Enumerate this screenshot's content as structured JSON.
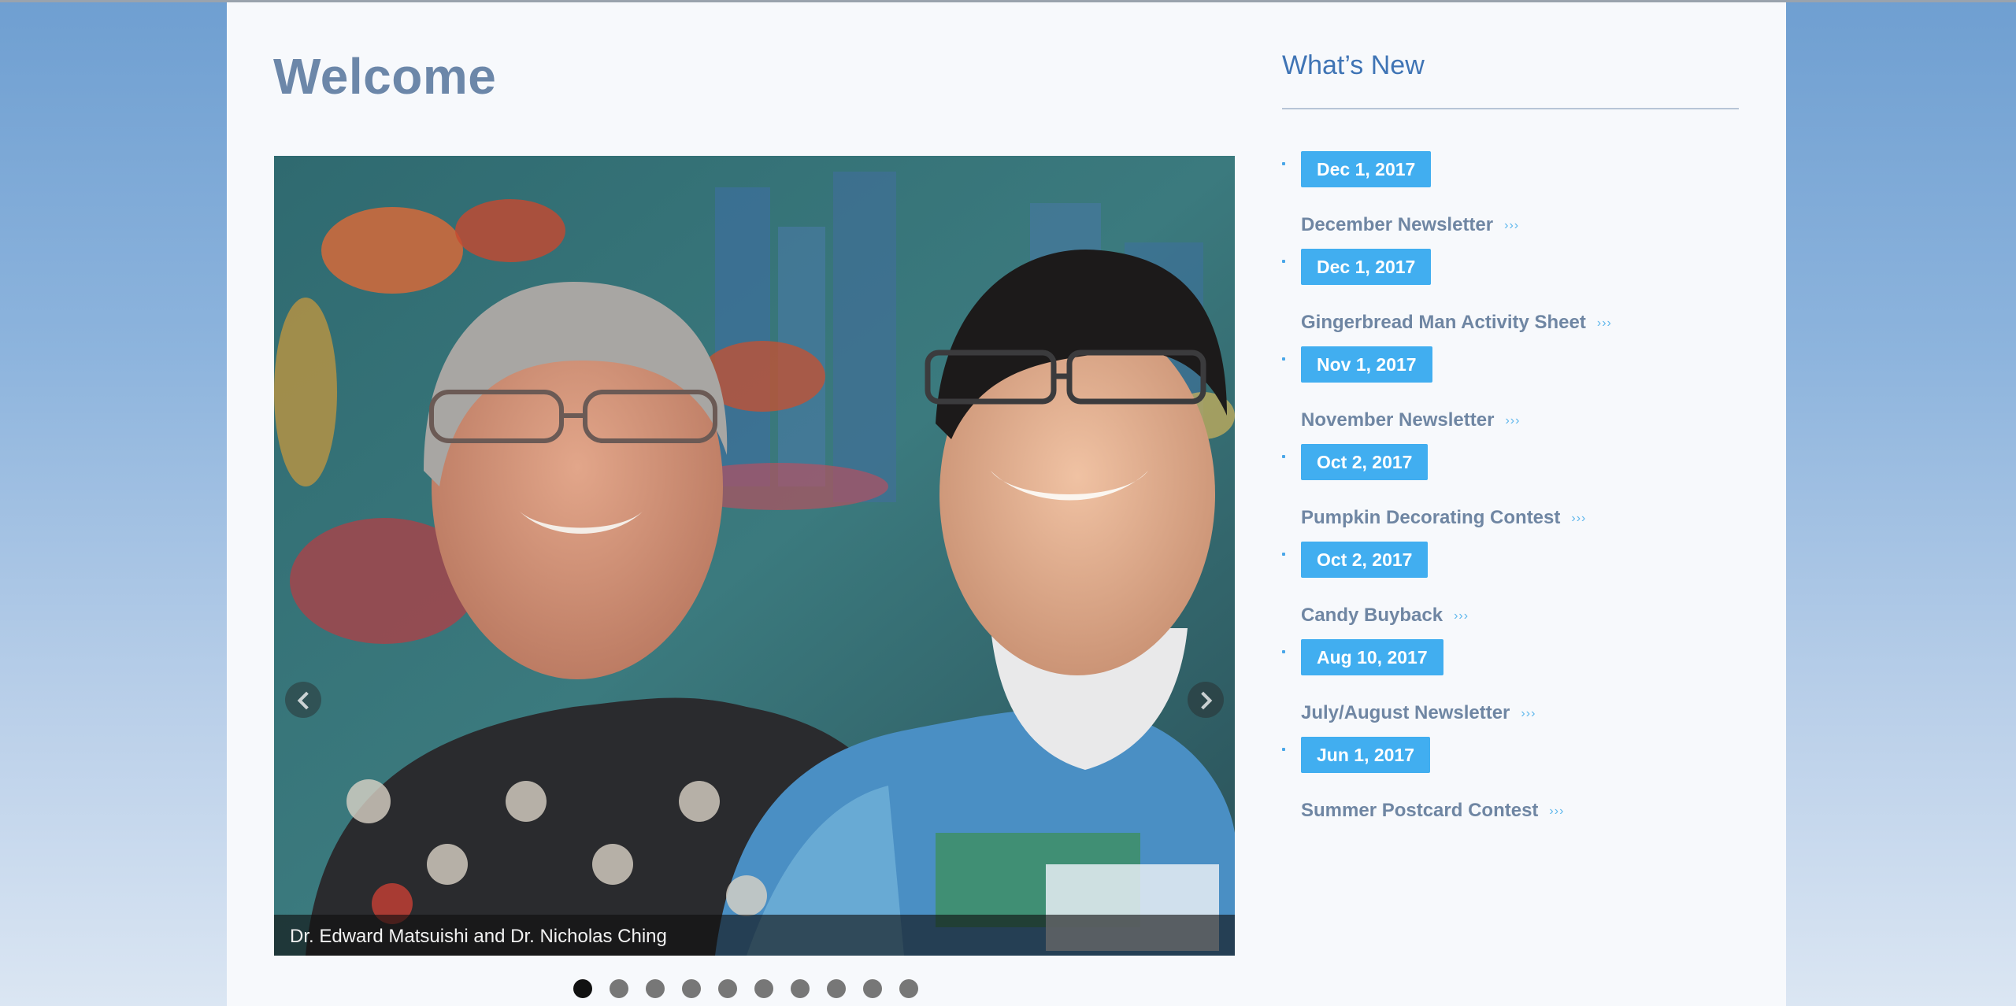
{
  "page": {
    "title": "Welcome"
  },
  "slider": {
    "caption": "Dr. Edward Matsuishi and Dr. Nicholas Ching",
    "dot_count": 10,
    "active_dot": 1,
    "prev_icon": "chevron-left-icon",
    "next_icon": "chevron-right-icon"
  },
  "whats_new": {
    "heading": "What’s New",
    "chevron_glyph": "›››",
    "items": [
      {
        "date": "Dec 1, 2017",
        "title": "December Newsletter"
      },
      {
        "date": "Dec 1, 2017",
        "title": "Gingerbread Man Activity Sheet"
      },
      {
        "date": "Nov 1, 2017",
        "title": "November Newsletter"
      },
      {
        "date": "Oct 2, 2017",
        "title": "Pumpkin Decorating Contest"
      },
      {
        "date": "Oct 2, 2017",
        "title": "Candy Buyback"
      },
      {
        "date": "Aug 10, 2017",
        "title": "July/August Newsletter"
      },
      {
        "date": "Jun 1, 2017",
        "title": "Summer Postcard Contest"
      }
    ]
  },
  "colors": {
    "title": "#6c87a9",
    "heading_link": "#3f74b5",
    "date_badge": "#41aef0",
    "news_link": "#6f86a3"
  }
}
